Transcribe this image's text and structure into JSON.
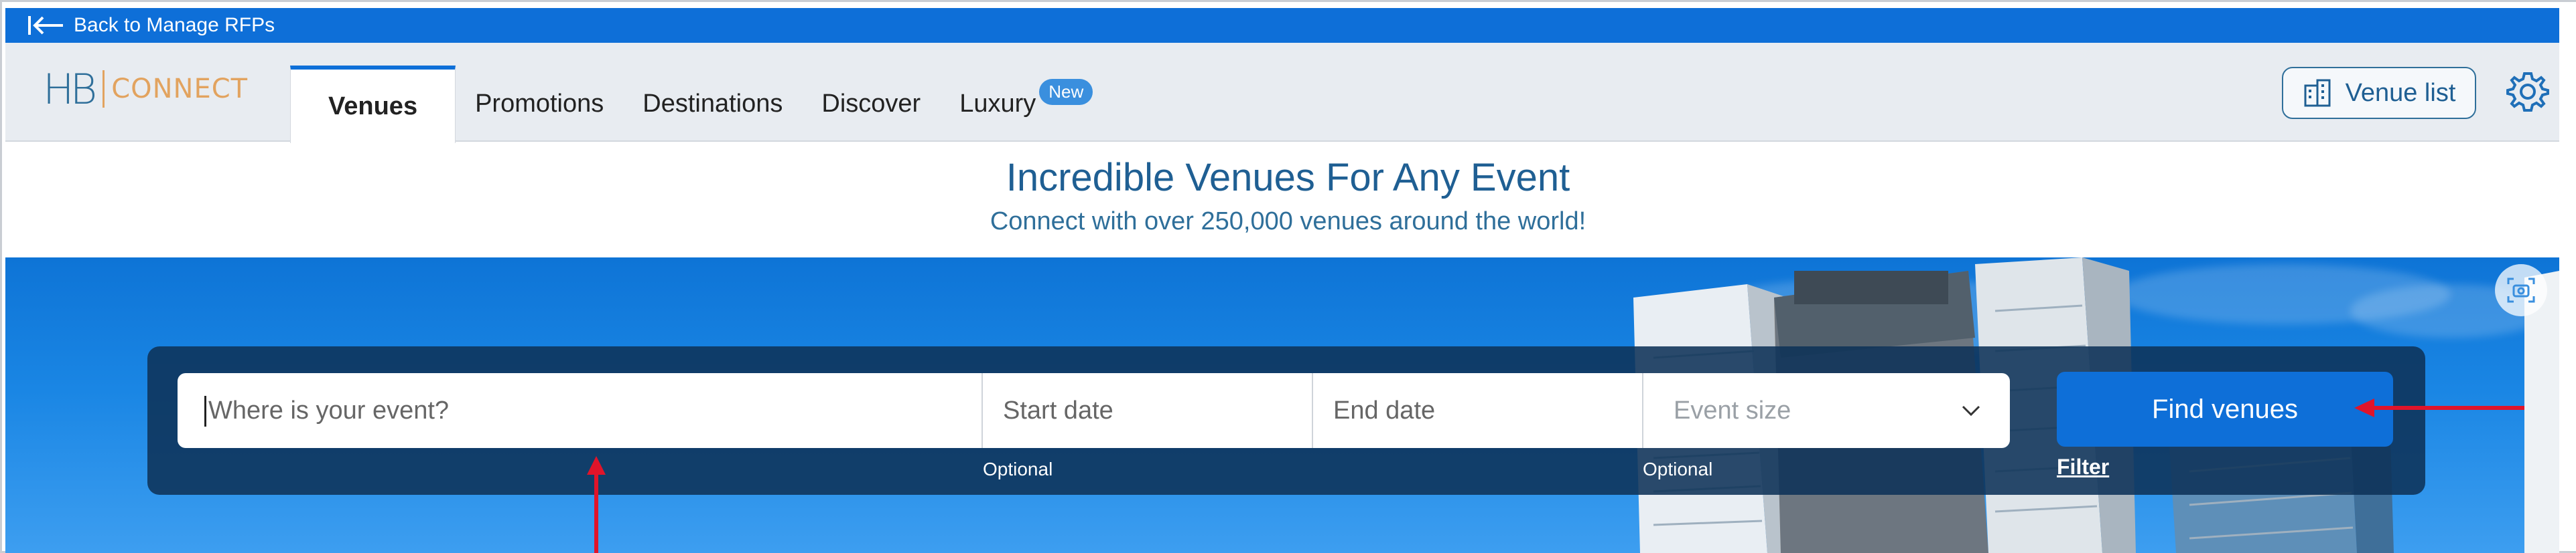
{
  "back_bar": {
    "label": "Back to Manage RFPs",
    "icon": "arrow-to-left-icon"
  },
  "logo": {
    "hb": "HB",
    "connect": "CONNECT"
  },
  "tabs": [
    {
      "label": "Venues",
      "active": true
    },
    {
      "label": "Promotions",
      "active": false
    },
    {
      "label": "Destinations",
      "active": false
    },
    {
      "label": "Discover",
      "active": false
    },
    {
      "label": "Luxury",
      "active": false,
      "badge": "New"
    }
  ],
  "header_actions": {
    "venue_list_label": "Venue list",
    "venue_list_icon": "building-icon",
    "settings_icon": "gear-icon"
  },
  "hero": {
    "title": "Incredible Venues For Any Event",
    "subtitle": "Connect with over 250,000 venues around the world!"
  },
  "search": {
    "where_placeholder": "Where is your event?",
    "start_placeholder": "Start date",
    "end_placeholder": "End date",
    "size_label": "Event size",
    "start_hint": "Optional",
    "end_hint": "Optional",
    "find_label": "Find venues",
    "filter_label": "Filter"
  },
  "colors": {
    "brand_blue": "#0e6fd8",
    "title_blue": "#1f5f93",
    "logo_orange": "#e2a35f",
    "annotation_red": "#e0142a"
  }
}
